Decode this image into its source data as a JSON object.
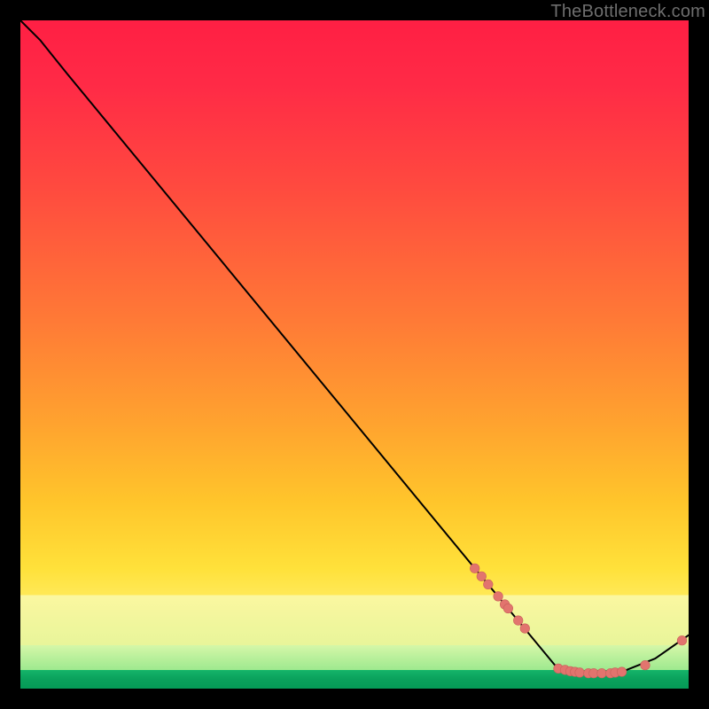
{
  "watermark": "TheBottleneck.com",
  "colors": {
    "curve_stroke": "#000000",
    "marker_fill": "#e2746e",
    "marker_stroke": "#c9615b"
  },
  "chart_data": {
    "type": "line",
    "title": "",
    "xlabel": "",
    "ylabel": "",
    "xlim": [
      0,
      100
    ],
    "ylim": [
      0,
      100
    ],
    "grid": false,
    "legend": false,
    "note": "No axis ticks or numeric labels are rendered; values below are read off the curve in 0–100 normalized plot coordinates (x left→right, y bottom→top).",
    "curve_points": [
      {
        "x": 0,
        "y": 100
      },
      {
        "x": 3,
        "y": 97
      },
      {
        "x": 5,
        "y": 94.5
      },
      {
        "x": 7,
        "y": 92
      },
      {
        "x": 68,
        "y": 18
      },
      {
        "x": 80,
        "y": 3.5
      },
      {
        "x": 82,
        "y": 2.7
      },
      {
        "x": 85,
        "y": 2.3
      },
      {
        "x": 90,
        "y": 2.5
      },
      {
        "x": 95,
        "y": 4.5
      },
      {
        "x": 100,
        "y": 8
      }
    ],
    "markers": [
      {
        "x": 68.0,
        "y": 18.0
      },
      {
        "x": 69.0,
        "y": 16.8
      },
      {
        "x": 70.0,
        "y": 15.6
      },
      {
        "x": 71.5,
        "y": 13.8
      },
      {
        "x": 72.5,
        "y": 12.6
      },
      {
        "x": 73.0,
        "y": 12.0
      },
      {
        "x": 74.5,
        "y": 10.2
      },
      {
        "x": 75.5,
        "y": 9.0
      },
      {
        "x": 80.5,
        "y": 3.0
      },
      {
        "x": 81.5,
        "y": 2.8
      },
      {
        "x": 82.3,
        "y": 2.6
      },
      {
        "x": 83.0,
        "y": 2.5
      },
      {
        "x": 83.7,
        "y": 2.4
      },
      {
        "x": 85.0,
        "y": 2.3
      },
      {
        "x": 85.8,
        "y": 2.3
      },
      {
        "x": 87.0,
        "y": 2.3
      },
      {
        "x": 88.3,
        "y": 2.3
      },
      {
        "x": 89.0,
        "y": 2.4
      },
      {
        "x": 90.0,
        "y": 2.5
      },
      {
        "x": 93.5,
        "y": 3.5
      },
      {
        "x": 99.0,
        "y": 7.2
      }
    ]
  }
}
